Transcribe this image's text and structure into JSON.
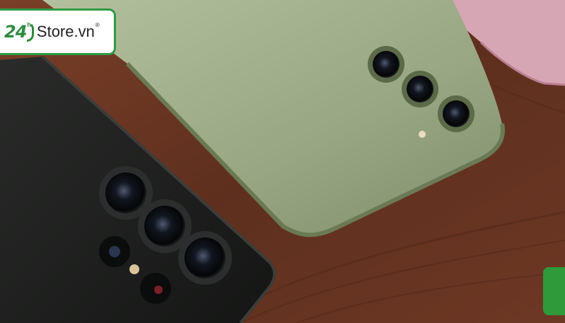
{
  "logo": {
    "number": "24",
    "hour_mark": "h",
    "brand": "Store.vn",
    "registered": "®",
    "border_color": "#2f9a45",
    "text_color": "#2e8b3e"
  },
  "scene": {
    "description_icon": "smartphone-cameras",
    "table_color": "#6b3522",
    "green_phone_color": "#9fae8a",
    "black_phone_color": "#1c1d1c",
    "pink_phone_color": "#d8a7b5"
  },
  "side_tab": {
    "color": "#2e9a3a"
  }
}
